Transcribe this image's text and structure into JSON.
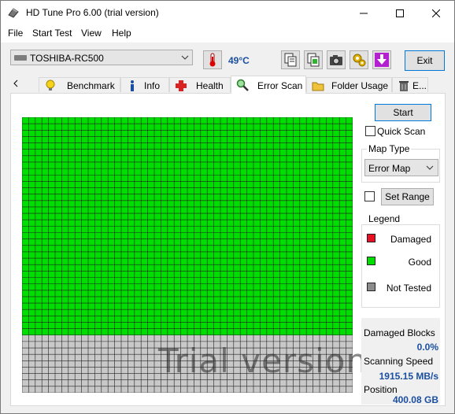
{
  "window": {
    "title": "HD Tune Pro 6.00 (trial version)"
  },
  "menu": [
    "File",
    "Start Test",
    "View",
    "Help"
  ],
  "toolbar": {
    "drive": "TOSHIBA-RC500",
    "temperature": "49°C",
    "exit_label": "Exit"
  },
  "tabs": [
    {
      "label": "Benchmark",
      "icon": "bulb-icon"
    },
    {
      "label": "Info",
      "icon": "info-icon"
    },
    {
      "label": "Health",
      "icon": "health-cross-icon"
    },
    {
      "label": "Error Scan",
      "icon": "magnifier-icon",
      "active": true
    },
    {
      "label": "Folder Usage",
      "icon": "folder-icon"
    },
    {
      "label": "E...",
      "icon": "trash-icon"
    }
  ],
  "controls": {
    "start_label": "Start",
    "quick_scan_label": "Quick Scan",
    "quick_scan_checked": false,
    "map_type_label": "Map Type",
    "map_type_value": "Error Map",
    "set_range_label": "Set Range",
    "set_range_checked": false
  },
  "legend": {
    "title": "Legend",
    "items": [
      {
        "label": "Damaged",
        "color": "#e81123"
      },
      {
        "label": "Good",
        "color": "#00dd00"
      },
      {
        "label": "Not Tested",
        "color": "#8c8c8c"
      }
    ]
  },
  "stats": {
    "damaged_blocks_label": "Damaged Blocks",
    "damaged_blocks_value": "0.0%",
    "scanning_speed_label": "Scanning Speed",
    "scanning_speed_value": "1915.15 MB/s",
    "position_label": "Position",
    "position_value": "400.08 GB"
  },
  "scan_map": {
    "columns": 50,
    "rows": 43,
    "tested_rows": 34,
    "tested_color": "#00dd00",
    "untested_color": "#c8c8c8",
    "watermark": "Trial version"
  },
  "colors": {
    "accent": "#1a4fa0",
    "focus_border": "#0078d7"
  }
}
